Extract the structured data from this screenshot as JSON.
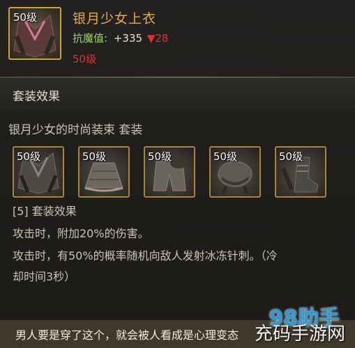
{
  "item": {
    "level_badge": "50级",
    "name": "银月少女上衣",
    "stat_label": "抗魔值:",
    "stat_value": "+335",
    "stat_down": "▼28",
    "required_level": "50级"
  },
  "set": {
    "title": "套装效果",
    "name": "银月少女的时尚装束 套装",
    "pieces": [
      {
        "level": "50级",
        "icon": "robe-icon"
      },
      {
        "level": "50级",
        "icon": "skirt-icon"
      },
      {
        "level": "50级",
        "icon": "pants-icon"
      },
      {
        "level": "50级",
        "icon": "shoulder-icon"
      },
      {
        "level": "50级",
        "icon": "boots-icon"
      }
    ],
    "effects": [
      "[5] 套装效果",
      "攻击时，附加20%的伤害。",
      "攻击时，有50%的概率随机向敌人发射冰冻针刺。（冷",
      "却时间3秒）"
    ]
  },
  "caption": "男人要是穿了这个，就会被人看成是心理变态",
  "watermark": {
    "logo": "98助手",
    "text": "充码手游网"
  },
  "colors": {
    "item_name": "#e8a848",
    "stat_label": "#9fd06a",
    "stat_down": "#e0322a",
    "frame_gold": "#c9a43a"
  }
}
